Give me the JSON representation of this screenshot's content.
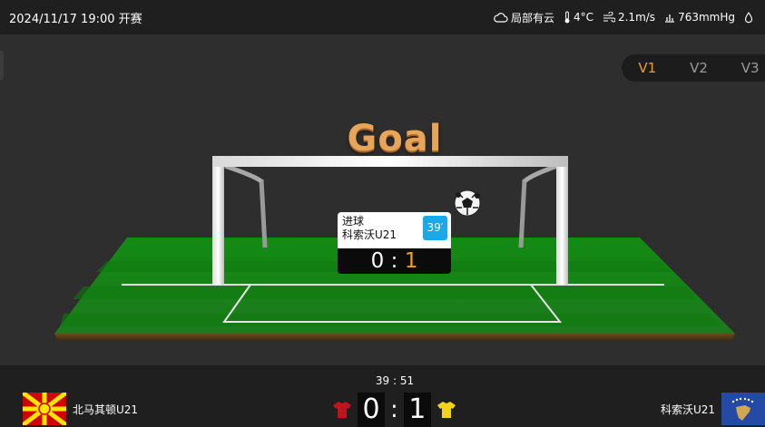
{
  "header": {
    "kickoff": "2024/11/17 19:00 开赛",
    "weather": [
      {
        "icon": "cloud-icon",
        "text": "局部有云"
      },
      {
        "icon": "thermometer-icon",
        "text": "4°C"
      },
      {
        "icon": "wind-icon",
        "text": "2.1m/s"
      },
      {
        "icon": "pressure-icon",
        "text": "763mmHg"
      },
      {
        "icon": "humidity-icon",
        "text": ""
      }
    ]
  },
  "versions": {
    "items": [
      "V1",
      "V2",
      "V3"
    ],
    "active": "V1"
  },
  "animation": {
    "title": "Goal",
    "event": {
      "type": "进球",
      "team": "科索沃U21",
      "minute": "39′",
      "score_home": "0",
      "score_sep": ":",
      "score_away": "1"
    }
  },
  "match": {
    "clock": "39 : 51",
    "home": {
      "name": "北马其顿U21",
      "score": "0",
      "shirt_color": "#c0141c"
    },
    "away": {
      "name": "科索沃U21",
      "score": "1",
      "shirt_color": "#f2d21a"
    },
    "score_sep": ":"
  },
  "colors": {
    "accent": "#f0a020",
    "minute_badge": "#1aa8e6",
    "grass": "#1f8a1f",
    "background": "#2e2e2e"
  }
}
